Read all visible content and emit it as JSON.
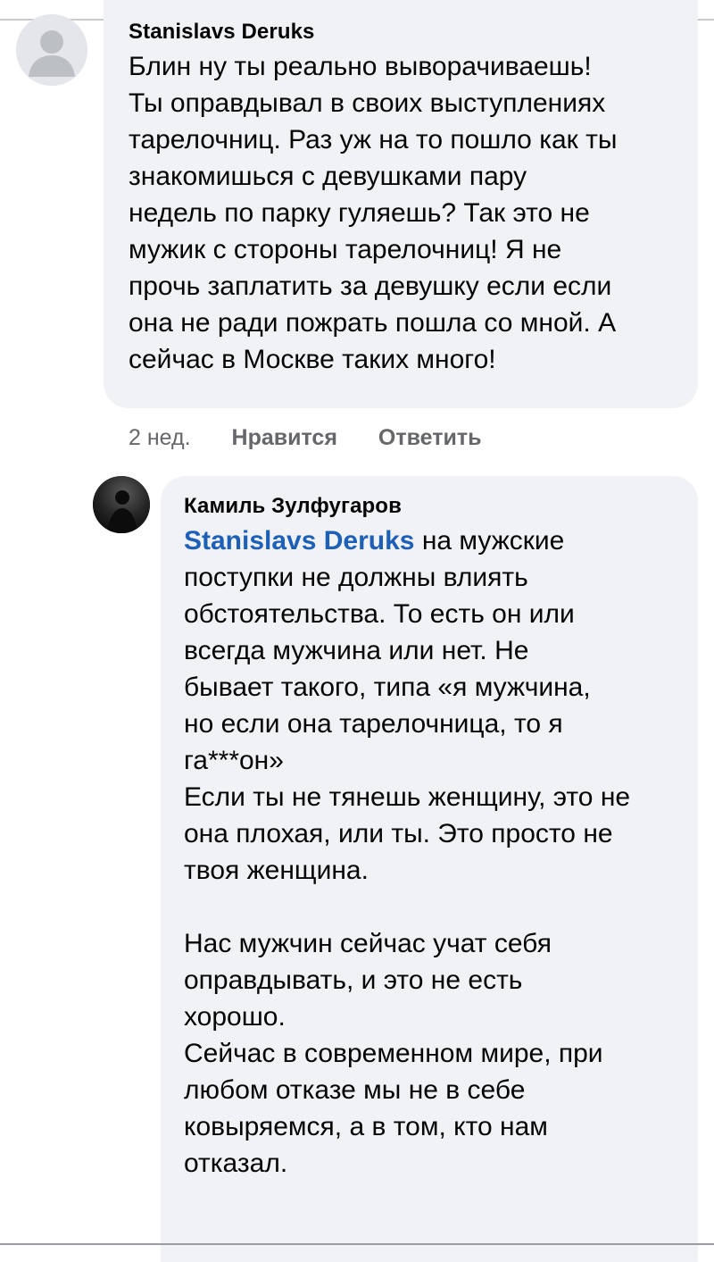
{
  "comment": {
    "author": "Stanislavs Deruks",
    "text": "Блин ну ты реально выворачиваешь!\nТы оправдывал в своих выступлениях\nтарелочниц. Раз уж на то пошло как ты\nзнакомишься с девушками пару\nнедель по парку гуляешь? Так это не\nмужик с стороны тарелочниц! Я не\nпрочь заплатить за девушку если если\nона не ради пожрать пошла со мной. А\nсейчас в Москве таких много!",
    "time": "2 нед.",
    "like_label": "Нравится",
    "reply_label": "Ответить"
  },
  "reply": {
    "author": "Камиль Зулфугаров",
    "mention": "Stanislavs Deruks",
    "text_after_mention": " на мужские\nпоступки не должны влиять\nобстоятельства. То есть он или\nвсегда мужчина или нет. Не\nбывает такого, типа «я мужчина,\nно если она тарелочница, то я\nга***он»\nЕсли ты не тянешь женщину, это не\nона плохая, или ты. Это просто не\nтвоя женщина.\n\nНас мужчин сейчас учат себя\nоправдывать, и это не есть\nхорошо.\nСейчас в современном мире, при\nлюбом отказе мы не в себе\nковыряемся, а в том, кто нам\nотказал."
  },
  "colors": {
    "bubble_bg": "#f0f2f5",
    "mention": "#1e5fb8",
    "secondary_text": "#65676b"
  }
}
